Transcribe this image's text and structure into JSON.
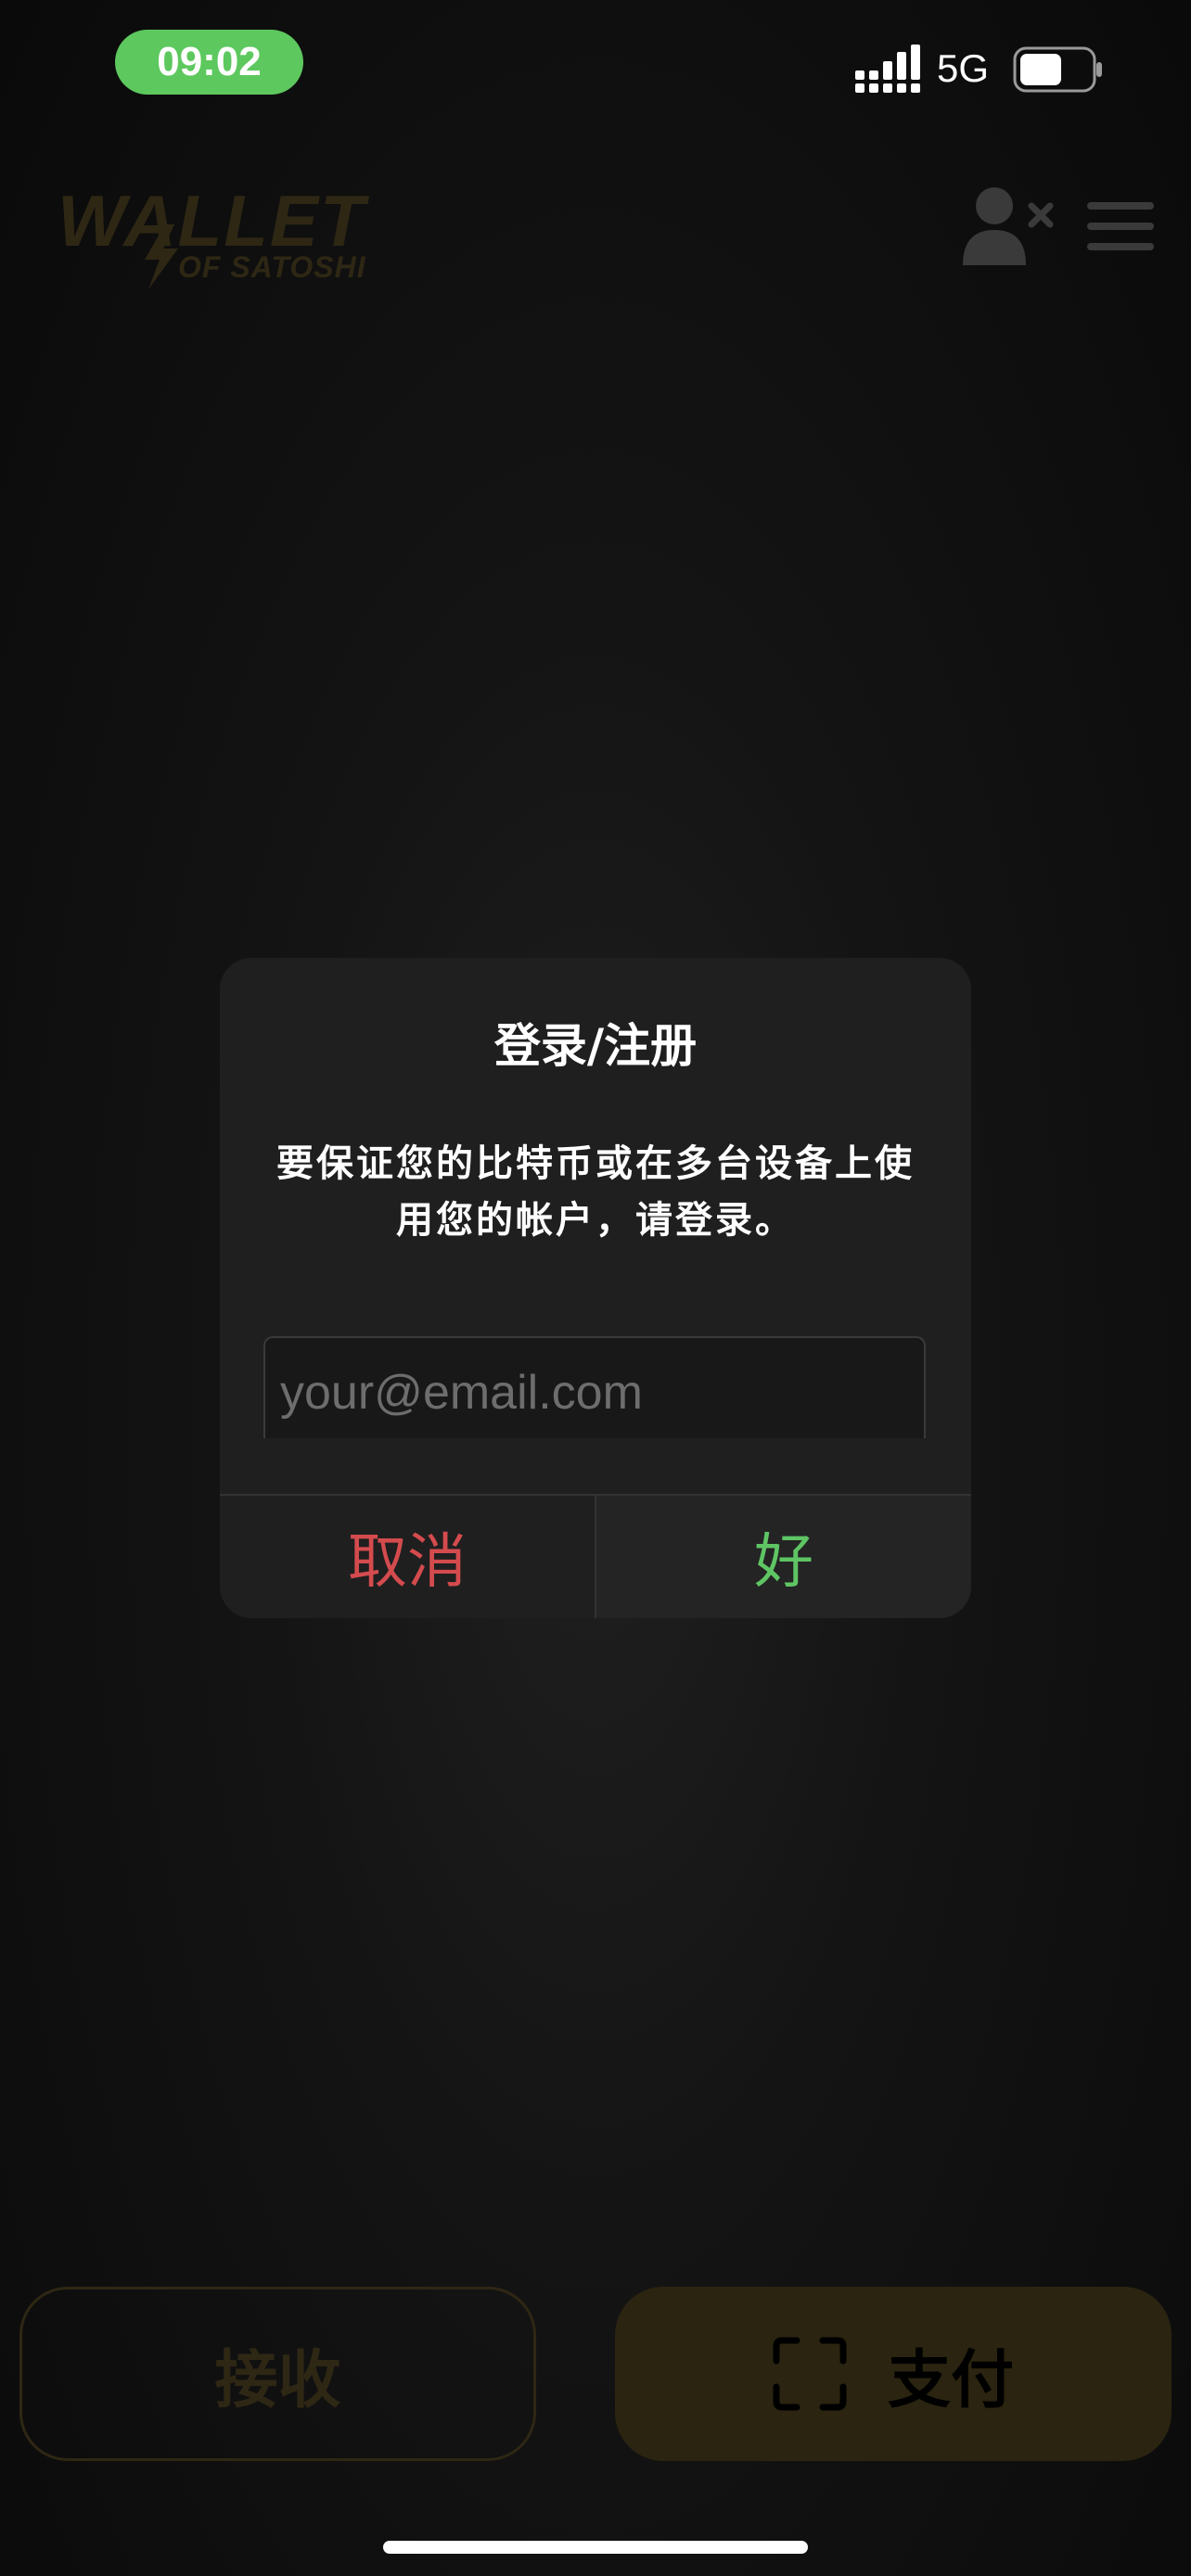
{
  "status_bar": {
    "time": "09:02",
    "network": "5G",
    "battery_level": 0.6,
    "icons": [
      "signal-icon",
      "battery-icon"
    ]
  },
  "header": {
    "logo_main": "WALLET",
    "logo_sub": "OF SATOSHI",
    "icons": [
      "account-x-icon",
      "menu-icon"
    ]
  },
  "dialog": {
    "title": "登录/注册",
    "message": "要保证您的比特币或在多台设备上使用您的帐户，请登录。",
    "email": {
      "value": "",
      "placeholder": "your@email.com"
    },
    "cancel_label": "取消",
    "ok_label": "好"
  },
  "actions": {
    "receive_label": "接收",
    "pay_label": "支付",
    "pay_icon": "scan-icon"
  },
  "colors": {
    "time_pill": "#5dc85e",
    "cancel": "#d44b4e",
    "ok": "#5fc564",
    "brand_dimmed": "#2e2714",
    "pay_dimmed": "#2a2410"
  }
}
